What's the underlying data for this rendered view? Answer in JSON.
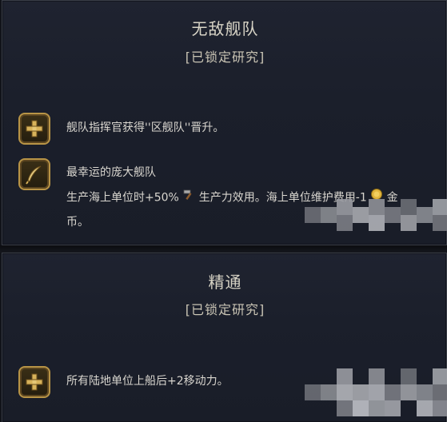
{
  "panels": [
    {
      "title": "无敌舰队",
      "subtitle": "[已锁定研究]",
      "items": [
        {
          "icon": "plus-icon",
          "lines": [
            "舰队指挥官获得''区舰队''晋升。"
          ]
        },
        {
          "icon": "quill-icon",
          "heading": "最幸运的庞大舰队",
          "line_part1": "生产海上单位时+50%",
          "line_icon1": "production-hammer-icon",
          "line_part2": " 生产力效用。海上单位维护费用-1",
          "line_icon2": "gold-coin-icon",
          "line_part3": " 金",
          "line3": "币。"
        }
      ]
    },
    {
      "title": "精通",
      "subtitle": "[已锁定研究]",
      "items": [
        {
          "icon": "plus-icon",
          "lines": [
            "所有陆地单位上船后+2移动力。"
          ]
        }
      ]
    }
  ],
  "colors": {
    "panel_bg": "#1d2130",
    "gold_border": "#b89446",
    "text": "#d9d6cf",
    "title": "#d8d4c6"
  }
}
